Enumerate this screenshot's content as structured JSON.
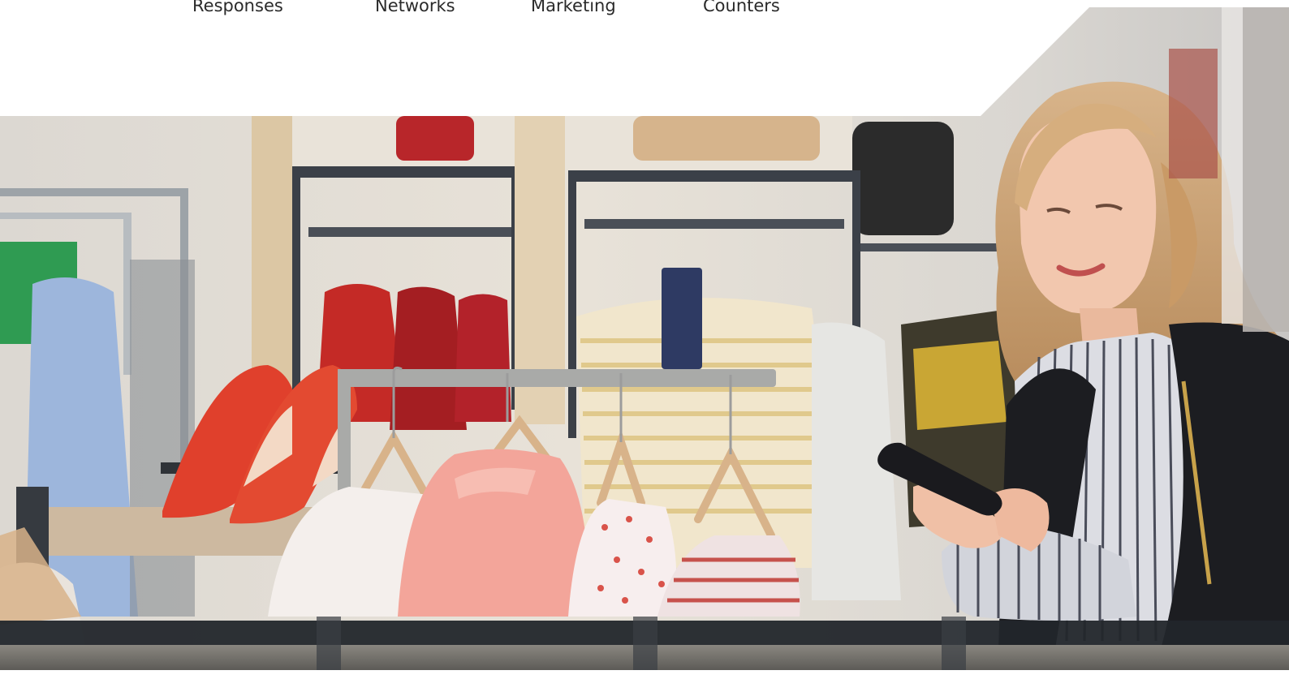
{
  "nav": {
    "items": [
      {
        "label": "Responses"
      },
      {
        "label": "Networks"
      },
      {
        "label": "Marketing"
      },
      {
        "label": "Counters"
      }
    ]
  },
  "hero": {
    "image": "fashion-store-shopper-with-phone",
    "colors": {
      "accent_green": "#2f9b52",
      "shoe_red": "#e0402c",
      "sweater_pink": "#f3a59a",
      "jacket_black": "#1c1d21"
    }
  }
}
